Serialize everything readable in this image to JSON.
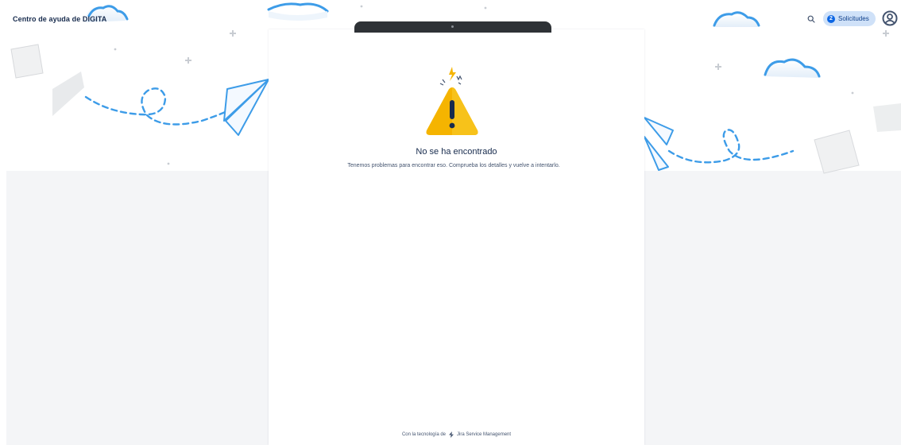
{
  "header": {
    "site_title": "Centro de ayuda de DIGITA",
    "search_icon": "search-icon",
    "requests": {
      "count": "2",
      "label": "Solicitudes"
    },
    "avatar_icon": "user-avatar-icon"
  },
  "error": {
    "icon": "warning-icon",
    "title": "No se ha encontrado",
    "description": "Tenemos problemas para encontrar eso. Comprueba los detalles y vuelve a intentarlo."
  },
  "footer": {
    "prefix": "Con la tecnología de",
    "product": "Jira Service Management",
    "product_icon": "jira-logo-icon"
  },
  "colors": {
    "accent": "#0c66e4",
    "pill_bg": "#cfe1f8",
    "warning": "#f5b400",
    "dash_blue": "#3d9ce8",
    "lower_bg": "#f4f5f7"
  }
}
